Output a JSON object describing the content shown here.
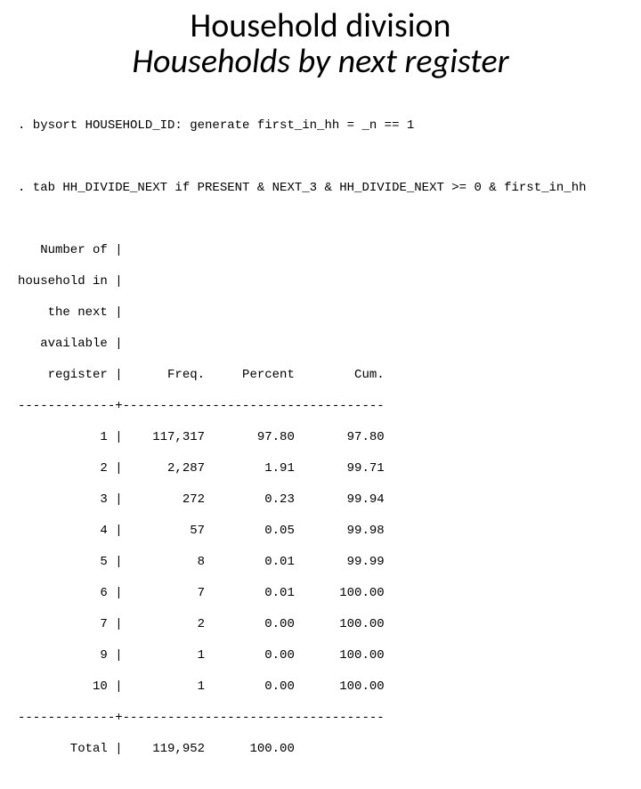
{
  "title": {
    "line1": "Household division",
    "line2": "Households by next register"
  },
  "commands": {
    "c1": ". bysort HOUSEHOLD_ID: generate first_in_hh = _n == 1",
    "c2": ". tab HH_DIVIDE_NEXT if PRESENT & NEXT_3 & HH_DIVIDE_NEXT >= 0 & first_in_hh"
  },
  "table_header": {
    "h1": "   Number of |",
    "h2": "household in |",
    "h3": "    the next |",
    "h4": "   available |",
    "h5": "    register |      Freq.     Percent        Cum."
  },
  "separator": "-------------+-----------------------------------",
  "rows": {
    "r1": "           1 |    117,317       97.80       97.80",
    "r2": "           2 |      2,287        1.91       99.71",
    "r3": "           3 |        272        0.23       99.94",
    "r4": "           4 |         57        0.05       99.98",
    "r5": "           5 |          8        0.01       99.99",
    "r6": "           6 |          7        0.01      100.00",
    "r7": "           7 |          2        0.00      100.00",
    "r8": "           9 |          1        0.00      100.00",
    "r9": "          10 |          1        0.00      100.00"
  },
  "total": "       Total |    119,952      100.00",
  "chart_data": {
    "type": "table",
    "title": "Number of household in the next available register",
    "columns": [
      "register",
      "Freq.",
      "Percent",
      "Cum."
    ],
    "rows": [
      {
        "register": 1,
        "freq": 117317,
        "percent": 97.8,
        "cum": 97.8
      },
      {
        "register": 2,
        "freq": 2287,
        "percent": 1.91,
        "cum": 99.71
      },
      {
        "register": 3,
        "freq": 272,
        "percent": 0.23,
        "cum": 99.94
      },
      {
        "register": 4,
        "freq": 57,
        "percent": 0.05,
        "cum": 99.98
      },
      {
        "register": 5,
        "freq": 8,
        "percent": 0.01,
        "cum": 99.99
      },
      {
        "register": 6,
        "freq": 7,
        "percent": 0.01,
        "cum": 100.0
      },
      {
        "register": 7,
        "freq": 2,
        "percent": 0.0,
        "cum": 100.0
      },
      {
        "register": 9,
        "freq": 1,
        "percent": 0.0,
        "cum": 100.0
      },
      {
        "register": 10,
        "freq": 1,
        "percent": 0.0,
        "cum": 100.0
      }
    ],
    "total": {
      "freq": 119952,
      "percent": 100.0
    }
  }
}
